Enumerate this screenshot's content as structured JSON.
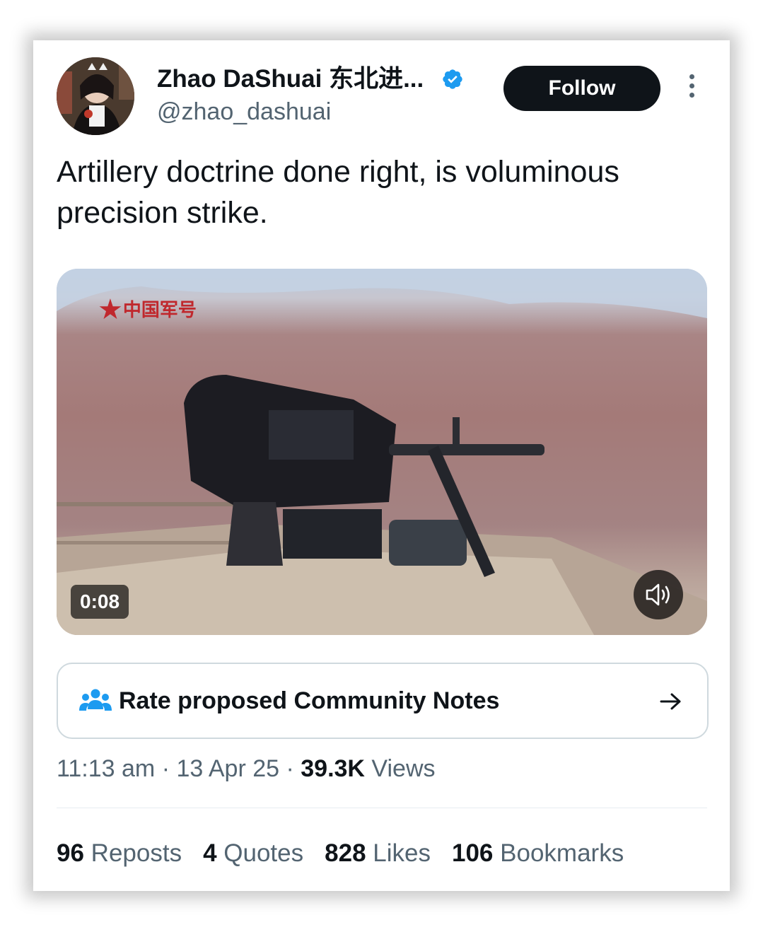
{
  "author": {
    "display_name": "Zhao DaShuai 东北进...",
    "handle": "@zhao_dashuai",
    "verified": true
  },
  "follow_label": "Follow",
  "tweet": {
    "text": "Artillery doctrine done right, is voluminous precision strike."
  },
  "media": {
    "watermark": "中国军号",
    "duration": "0:08"
  },
  "community_notes": {
    "label": "Rate proposed Community Notes"
  },
  "meta": {
    "time": "11:13 am",
    "sep1": " · ",
    "date": "13 Apr 25",
    "sep2": " · ",
    "views_count": "39.3K",
    "views_label": " Views"
  },
  "stats": [
    {
      "count": "96",
      "label": "Reposts"
    },
    {
      "count": "4",
      "label": "Quotes"
    },
    {
      "count": "828",
      "label": "Likes"
    },
    {
      "count": "106",
      "label": "Bookmarks"
    }
  ],
  "colors": {
    "text_primary": "#0f1419",
    "text_secondary": "#536471",
    "verified_blue": "#1d9bf0",
    "border": "#cfd9de"
  }
}
